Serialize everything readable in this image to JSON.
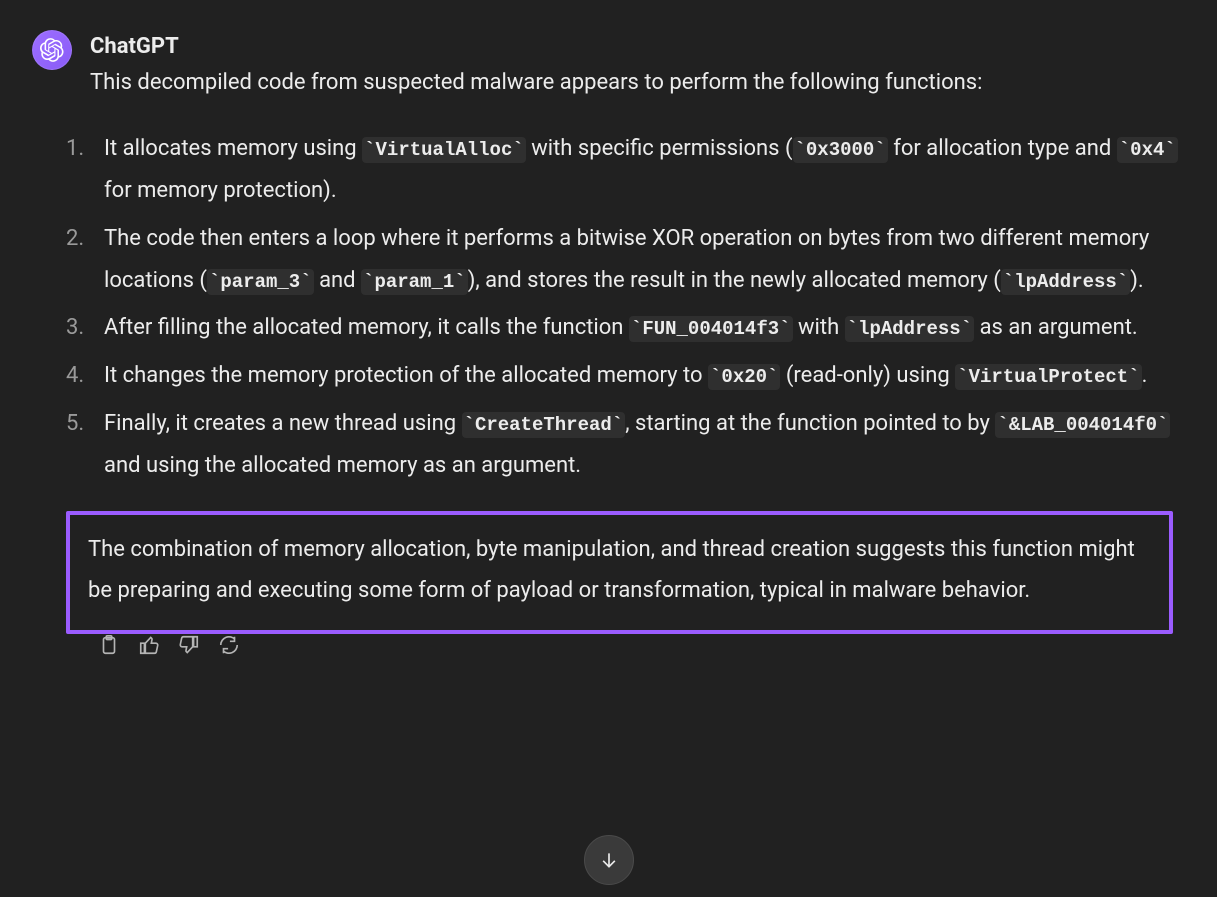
{
  "message": {
    "author": "ChatGPT",
    "intro": "This decompiled code from suspected malware appears to perform the following functions:",
    "items": [
      {
        "parts": [
          {
            "t": "text",
            "v": "It allocates memory using "
          },
          {
            "t": "code",
            "v": "VirtualAlloc"
          },
          {
            "t": "text",
            "v": " with specific permissions ("
          },
          {
            "t": "code",
            "v": "0x3000"
          },
          {
            "t": "text",
            "v": " for allocation type and "
          },
          {
            "t": "code",
            "v": "0x4"
          },
          {
            "t": "text",
            "v": " for memory protection)."
          }
        ]
      },
      {
        "parts": [
          {
            "t": "text",
            "v": "The code then enters a loop where it performs a bitwise XOR operation on bytes from two different memory locations ("
          },
          {
            "t": "code",
            "v": "param_3"
          },
          {
            "t": "text",
            "v": " and "
          },
          {
            "t": "code",
            "v": "param_1"
          },
          {
            "t": "text",
            "v": "), and stores the result in the newly allocated memory ("
          },
          {
            "t": "code",
            "v": "lpAddress"
          },
          {
            "t": "text",
            "v": ")."
          }
        ]
      },
      {
        "parts": [
          {
            "t": "text",
            "v": "After filling the allocated memory, it calls the function "
          },
          {
            "t": "code",
            "v": "FUN_004014f3"
          },
          {
            "t": "text",
            "v": " with "
          },
          {
            "t": "code",
            "v": "lpAddress"
          },
          {
            "t": "text",
            "v": " as an argument."
          }
        ]
      },
      {
        "parts": [
          {
            "t": "text",
            "v": "It changes the memory protection of the allocated memory to "
          },
          {
            "t": "code",
            "v": "0x20"
          },
          {
            "t": "text",
            "v": " (read-only) using "
          },
          {
            "t": "code",
            "v": "VirtualProtect"
          },
          {
            "t": "text",
            "v": "."
          }
        ]
      },
      {
        "parts": [
          {
            "t": "text",
            "v": "Finally, it creates a new thread using "
          },
          {
            "t": "code",
            "v": "CreateThread"
          },
          {
            "t": "text",
            "v": ", starting at the function pointed to by "
          },
          {
            "t": "code",
            "v": "&LAB_004014f0"
          },
          {
            "t": "text",
            "v": " and using the allocated memory as an argument."
          }
        ]
      }
    ],
    "highlight": "The combination of memory allocation, byte manipulation, and thread creation suggests this function might be preparing and executing some form of payload or transformation, typical in malware behavior."
  },
  "actions": {
    "copy": "copy",
    "like": "thumbs-up",
    "dislike": "thumbs-down",
    "regenerate": "regenerate"
  }
}
